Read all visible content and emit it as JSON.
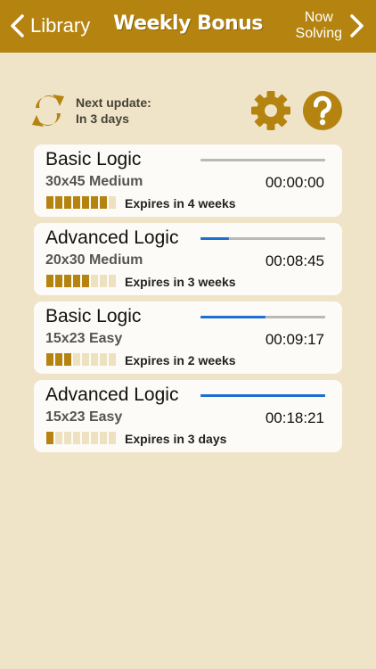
{
  "nav": {
    "back_label": "Library",
    "title": "Weekly Bonus",
    "right_line1": "Now",
    "right_line2": "Solving"
  },
  "update": {
    "line1": "Next update:",
    "line2": "In 3 days"
  },
  "colors": {
    "accent": "#B58410",
    "background": "#EFE4C8",
    "card": "#FCFBF7",
    "progress": "#1F6FD0"
  },
  "puzzles": [
    {
      "title": "Basic Logic",
      "size": "30x45 Medium",
      "time": "00:00:00",
      "progress": 0.0,
      "segments_filled": 7,
      "segments_total": 8,
      "expires": "Expires in 4 weeks"
    },
    {
      "title": "Advanced Logic",
      "size": "20x30 Medium",
      "time": "00:08:45",
      "progress": 0.23,
      "segments_filled": 5,
      "segments_total": 8,
      "expires": "Expires in 3 weeks"
    },
    {
      "title": "Basic Logic",
      "size": "15x23 Easy",
      "time": "00:09:17",
      "progress": 0.52,
      "segments_filled": 3,
      "segments_total": 8,
      "expires": "Expires in 2 weeks"
    },
    {
      "title": "Advanced Logic",
      "size": "15x23 Easy",
      "time": "00:18:21",
      "progress": 1.0,
      "segments_filled": 1,
      "segments_total": 8,
      "expires": "Expires in 3 days"
    }
  ]
}
